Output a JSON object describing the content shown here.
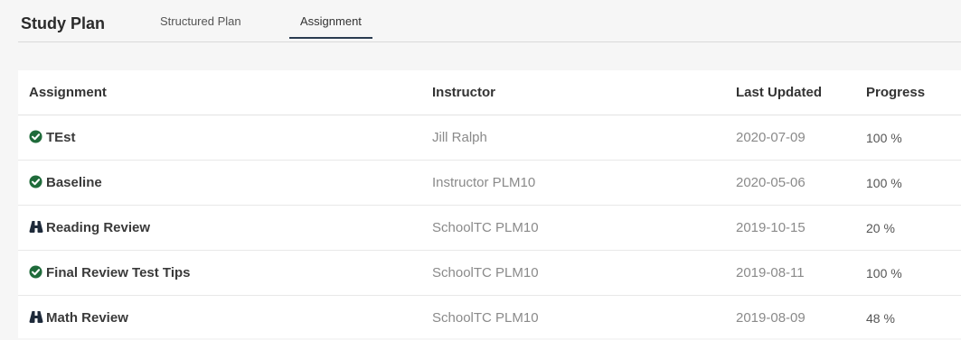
{
  "header": {
    "title": "Study Plan",
    "tabs": [
      {
        "label": "Structured Plan",
        "active": false
      },
      {
        "label": "Assignment",
        "active": true
      }
    ]
  },
  "table": {
    "columns": {
      "assignment": "Assignment",
      "instructor": "Instructor",
      "last_updated": "Last Updated",
      "progress": "Progress"
    },
    "rows": [
      {
        "assignment": "TEst",
        "icon": "check-circle-icon",
        "instructor": "Jill Ralph",
        "last_updated": "2020-07-09",
        "progress": "100 %"
      },
      {
        "assignment": "Baseline",
        "icon": "check-circle-icon",
        "instructor": "Instructor PLM10",
        "last_updated": "2020-05-06",
        "progress": "100 %"
      },
      {
        "assignment": "Reading Review",
        "icon": "binoculars-icon",
        "instructor": "SchoolTC PLM10",
        "last_updated": "2019-10-15",
        "progress": "20 %"
      },
      {
        "assignment": "Final Review Test Tips",
        "icon": "check-circle-icon",
        "instructor": "SchoolTC PLM10",
        "last_updated": "2019-08-11",
        "progress": "100 %"
      },
      {
        "assignment": "Math Review",
        "icon": "binoculars-icon",
        "instructor": "SchoolTC PLM10",
        "last_updated": "2019-08-09",
        "progress": "48 %"
      }
    ]
  },
  "colors": {
    "check": "#1f6b3a",
    "binoculars": "#1e2a3a",
    "tab_underline": "#2a3b50"
  }
}
